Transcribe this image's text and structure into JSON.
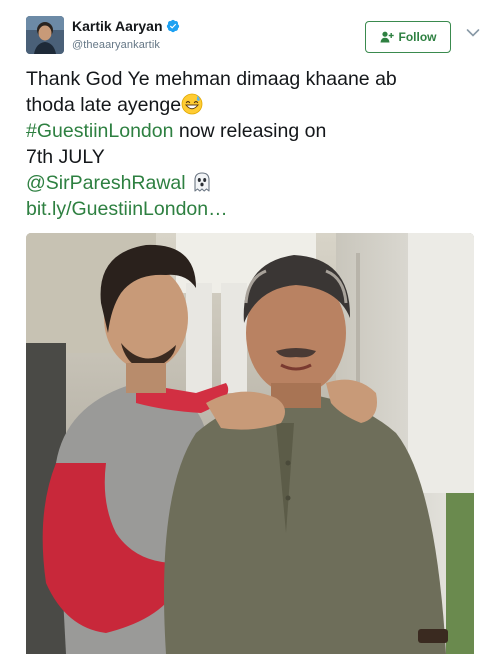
{
  "user": {
    "display_name": "Kartik Aaryan",
    "handle": "@theaaryankartik",
    "verified": true,
    "avatar_icon": "profile-photo"
  },
  "actions": {
    "follow_label": "Follow",
    "follow_icon": "add-person-icon",
    "menu_icon": "chevron-down-icon"
  },
  "tweet": {
    "line1": "Thank God Ye mehman dimaag khaane ab",
    "line2": "thoda late ayenge",
    "line2_emoji": "grinning-sweat-emoji",
    "hashtag": "#GuestiinLondon",
    "line3_rest": " now releasing on",
    "line4": "7th JULY",
    "mention": "@SirPareshRawal",
    "mention_emoji": "ghost-emoji",
    "url": "bit.ly/GuestiinLondon…"
  },
  "media": {
    "type": "photo",
    "description_icon": "photo-two-men"
  },
  "colors": {
    "link": "#2e8041",
    "verified": "#1da1f2",
    "text": "#14171a",
    "secondary": "#657786"
  }
}
